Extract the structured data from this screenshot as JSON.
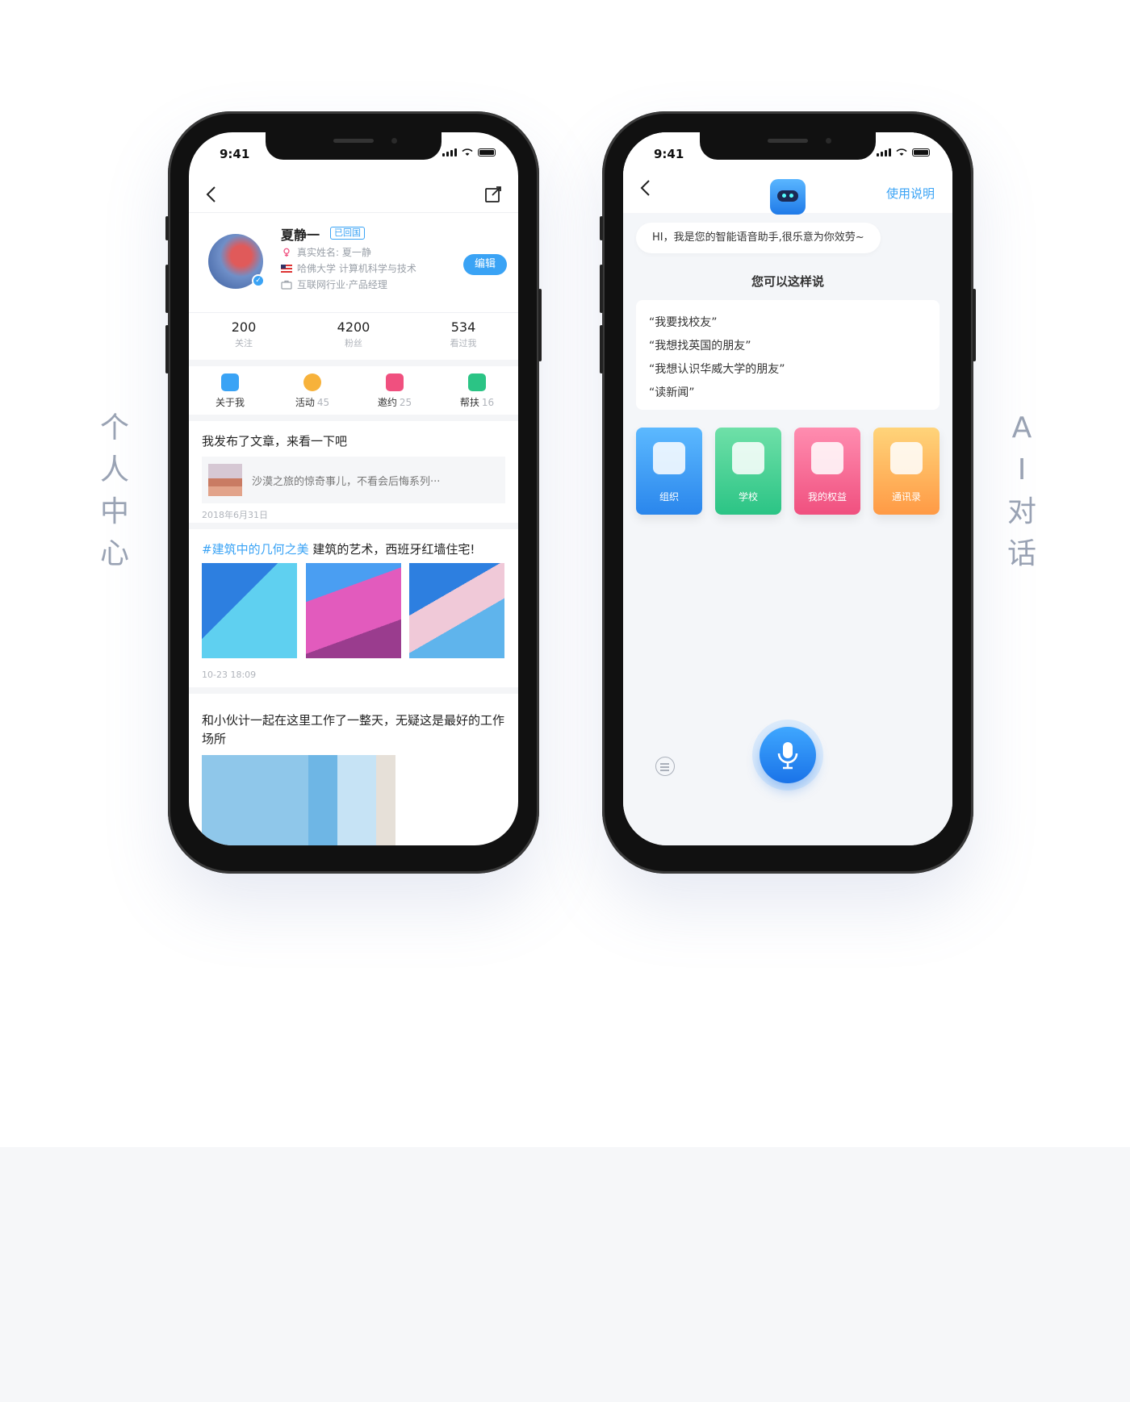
{
  "labels": {
    "left": [
      "个",
      "人",
      "中",
      "心"
    ],
    "right": [
      "A",
      "I",
      "对",
      "话"
    ]
  },
  "profile_screen": {
    "status_time": "9:41",
    "user": {
      "name": "夏静一",
      "badge": "已回国",
      "real_name": "真实姓名: 夏一静",
      "school": "哈佛大学 计算机科学与技术",
      "industry": "互联网行业·产品经理",
      "edit_label": "编辑"
    },
    "stats": [
      {
        "num": "200",
        "label": "关注"
      },
      {
        "num": "4200",
        "label": "粉丝"
      },
      {
        "num": "534",
        "label": "看过我"
      }
    ],
    "quick": [
      {
        "label": "关于我",
        "count": "",
        "color": "#3aa3f5"
      },
      {
        "label": "活动",
        "count": "45",
        "color": "#f7b23b"
      },
      {
        "label": "邀约",
        "count": "25",
        "color": "#f0507f"
      },
      {
        "label": "帮扶",
        "count": "16",
        "color": "#2bc485"
      }
    ],
    "post1": {
      "title": "我发布了文章，来看一下吧",
      "article": "沙漠之旅的惊奇事儿，不看会后悔系列···",
      "date": "2018年6月31日"
    },
    "post2": {
      "tag": "#建筑中的几何之美",
      "title": " 建筑的艺术，西班牙红墙住宅!",
      "date": "10-23 18:09"
    },
    "post3": {
      "title": "和小伙计一起在这里工作了一整天，无疑这是最好的工作场所"
    }
  },
  "ai_screen": {
    "status_time": "9:41",
    "help_link": "使用说明",
    "greeting": "HI，我是您的智能语音助手,很乐意为你效劳~",
    "prompt_title": "您可以这样说",
    "phrases": [
      "“我要找校友”",
      "“我想找英国的朋友”",
      "“我想认识华威大学的朋友”",
      "“读新闻”"
    ],
    "tiles": [
      "组织",
      "学校",
      "我的权益",
      "通讯录"
    ]
  }
}
